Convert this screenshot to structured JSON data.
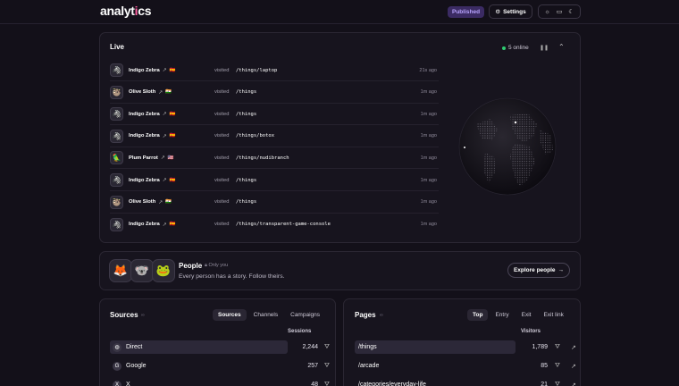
{
  "header": {
    "logo_main": "analyt",
    "logo_accent": "i",
    "logo_tail": "cs",
    "published_label": "Published",
    "settings_label": "Settings",
    "theme_icons": [
      "sun-icon",
      "monitor-icon",
      "moon-icon"
    ]
  },
  "live": {
    "title": "Live",
    "online_label": "5 online",
    "visited_word": "visited",
    "visits": [
      {
        "name": "Indigo Zebra",
        "avatar": "🦓",
        "flag": "🇪🇸",
        "path": "/things/laptop",
        "time": "21s ago"
      },
      {
        "name": "Olive Sloth",
        "avatar": "🦥",
        "flag": "🇮🇳",
        "path": "/things",
        "time": "1m ago"
      },
      {
        "name": "Indigo Zebra",
        "avatar": "🦓",
        "flag": "🇪🇸",
        "path": "/things",
        "time": "1m ago"
      },
      {
        "name": "Indigo Zebra",
        "avatar": "🦓",
        "flag": "🇪🇸",
        "path": "/things/botox",
        "time": "1m ago"
      },
      {
        "name": "Plum Parrot",
        "avatar": "🦜",
        "flag": "🇺🇸",
        "path": "/things/nudibranch",
        "time": "1m ago"
      },
      {
        "name": "Indigo Zebra",
        "avatar": "🦓",
        "flag": "🇪🇸",
        "path": "/things",
        "time": "1m ago"
      },
      {
        "name": "Olive Sloth",
        "avatar": "🦥",
        "flag": "🇮🇳",
        "path": "/things",
        "time": "1m ago"
      },
      {
        "name": "Indigo Zebra",
        "avatar": "🦓",
        "flag": "🇪🇸",
        "path": "/things/transparent-game-console",
        "time": "1m ago"
      }
    ]
  },
  "people": {
    "title": "People",
    "only_you": "Only you",
    "subtitle": "Every person has a story. Follow theirs.",
    "explore_label": "Explore people",
    "avatars": [
      "🦊",
      "🐨",
      "🐸"
    ]
  },
  "sources": {
    "title": "Sources",
    "tabs": [
      "Sources",
      "Channels",
      "Campaigns"
    ],
    "active_tab": 0,
    "column": "Sessions",
    "rows": [
      {
        "label": "Direct",
        "icon": "◍",
        "value": "2,244",
        "share": 1.0
      },
      {
        "label": "Google",
        "icon": "G",
        "value": "257",
        "share": 0.0
      },
      {
        "label": "X",
        "icon": "X",
        "value": "48",
        "share": 0.0
      }
    ]
  },
  "pages": {
    "title": "Pages",
    "tabs": [
      "Top",
      "Entry",
      "Exit",
      "Exit link"
    ],
    "active_tab": 0,
    "column": "Visitors",
    "rows": [
      {
        "label": "/things",
        "value": "1,789",
        "share": 1.0
      },
      {
        "label": "/arcade",
        "value": "85",
        "share": 0.0
      },
      {
        "label": "/categories/everyday-life",
        "value": "21",
        "share": 0.0
      }
    ]
  },
  "colors": {
    "background": "#131019",
    "card": "#17141e",
    "accent_badge": "#3b2b63",
    "online": "#2ecc71",
    "logo_accent": "#ff5fa2"
  }
}
